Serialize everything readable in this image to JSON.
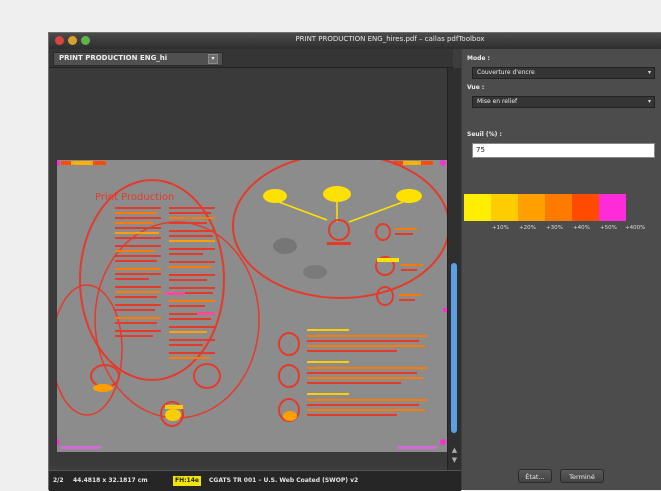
{
  "window": {
    "title": "PRINT PRODUCTION ENG_hires.pdf – callas pdfToolbox"
  },
  "tab": {
    "label": "PRINT PRODUCTION ENG_hi"
  },
  "document": {
    "heading": "Print Production"
  },
  "panel": {
    "mode_label": "Mode :",
    "mode_value": "Couverture d'encre",
    "view_label": "Vue :",
    "view_value": "Mise en relief",
    "threshold_label": "Seuil (%) :",
    "threshold_value": "75",
    "legend": [
      {
        "color": "#ffee00",
        "label": "+10%"
      },
      {
        "color": "#ffcc00",
        "label": "+20%"
      },
      {
        "color": "#ff9f00",
        "label": "+30%"
      },
      {
        "color": "#ff7a00",
        "label": "+40%"
      },
      {
        "color": "#ff4b00",
        "label": "+50%"
      },
      {
        "color": "#ff2bd8",
        "label": "+400%"
      }
    ],
    "button_1": "État...",
    "button_2": "Terminé"
  },
  "status": {
    "page": "2/2",
    "size": "44.4818 x 32.1817 cm",
    "badge": "FH:14e",
    "profile": "CGATS TR 001 – U.S. Web Coated (SWOP) v2"
  },
  "colors": {
    "accent": "#5ba0e2",
    "heatmap_red": "#e53a2a",
    "heatmap_yellow": "#ffe100"
  }
}
